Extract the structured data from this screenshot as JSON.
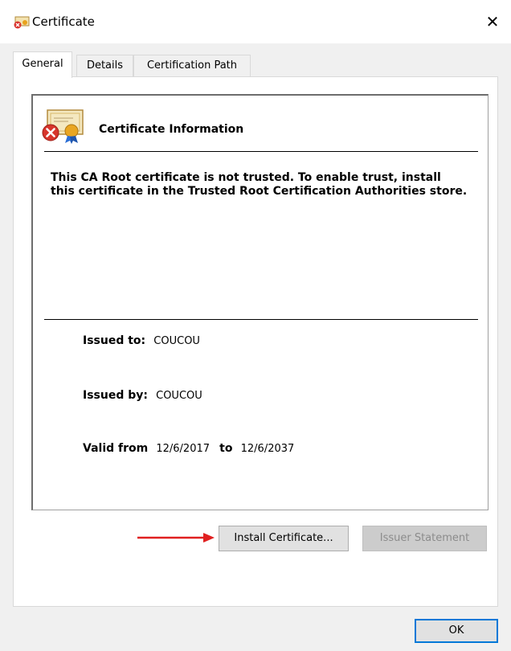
{
  "window": {
    "title": "Certificate",
    "icon": "certificate-error-icon",
    "close_glyph": "✕"
  },
  "tabs": [
    {
      "label": "General",
      "active": true
    },
    {
      "label": "Details",
      "active": false
    },
    {
      "label": "Certification Path",
      "active": false
    }
  ],
  "info": {
    "title": "Certificate Information",
    "warning": "This CA Root certificate is not trusted. To enable trust, install this certificate in the Trusted Root Certification Authorities store."
  },
  "details": {
    "issued_to_label": "Issued to:",
    "issued_to": "COUCOU",
    "issued_by_label": "Issued by:",
    "issued_by": "COUCOU",
    "valid_from_label": "Valid from",
    "valid_from": "12/6/2017",
    "to_label": "to",
    "valid_to": "12/6/2037"
  },
  "buttons": {
    "install": "Install Certificate...",
    "issuer": "Issuer Statement",
    "ok": "OK"
  },
  "colors": {
    "accent": "#0078d7",
    "arrow": "#e02020"
  }
}
